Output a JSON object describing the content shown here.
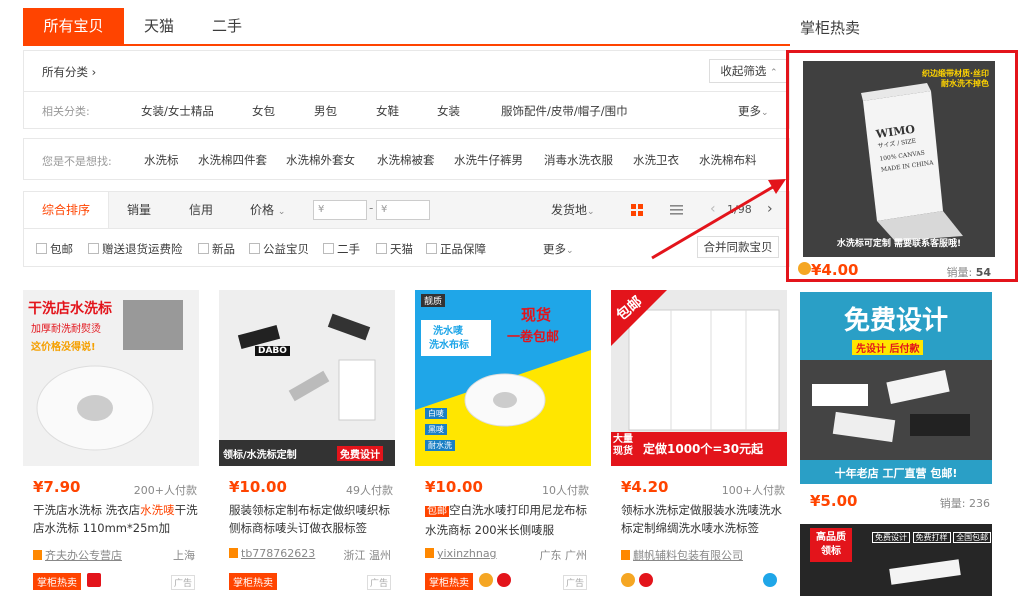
{
  "tabs": [
    {
      "label": "所有宝贝",
      "active": true
    },
    {
      "label": "天猫",
      "active": false
    },
    {
      "label": "二手",
      "active": false
    }
  ],
  "sidebar_title": "掌柜热卖",
  "filter": {
    "all_categories": "所有分类 ›",
    "collapse_btn": "收起筛选",
    "related_label": "相关分类:",
    "related_items": [
      "女装/女士精品",
      "女包",
      "男包",
      "女鞋",
      "女装",
      "服饰配件/皮带/帽子/围巾"
    ],
    "more_label": "更多",
    "suggest_label": "您是不是想找:",
    "suggest_items": [
      "水洗标",
      "水洗棉四件套",
      "水洗棉外套女",
      "水洗棉被套",
      "水洗牛仔裤男",
      "消毒水洗衣服",
      "水洗卫衣",
      "水洗棉布料"
    ]
  },
  "sort": {
    "items": [
      "综合排序",
      "销量",
      "信用",
      "价格"
    ],
    "price_min_placeholder": "¥",
    "price_dash": "-",
    "price_max_placeholder": "¥",
    "ship_from": "发货地",
    "page_indicator": "1/98"
  },
  "checks": {
    "items": [
      "包邮",
      "赠送退货运费险",
      "新品",
      "公益宝贝",
      "二手",
      "天猫",
      "正品保障"
    ],
    "more": "更多",
    "merge_btn": "合并同款宝贝"
  },
  "products": [
    {
      "img_text": [
        "干洗店水洗标",
        "加厚耐洗耐熨烫",
        "这价格没得说!"
      ],
      "price": "¥7.90",
      "paid": "200+人付款",
      "title_a": "干洗店水洗标 洗衣店",
      "title_hl": "水洗唛",
      "title_b": "干洗店水洗标 110mm*25m加",
      "shop": "齐夫办公专营店",
      "loc": "上海",
      "hot": "掌柜热卖",
      "ad": "广告"
    },
    {
      "img_text": [
        "DABO",
        "领标/水洗标定制",
        "免费设计"
      ],
      "price": "¥10.00",
      "paid": "49人付款",
      "title_a": "服装领标定制布标定做织唛织标侧标商标唛头订做衣服标签",
      "title_hl": "",
      "title_b": "",
      "shop": "tb778762623",
      "loc": "浙江 温州",
      "hot": "掌柜热卖",
      "ad": "广告"
    },
    {
      "img_text": [
        "靓质",
        "洗水唛",
        "洗水布标",
        "现货",
        "一卷包邮",
        "白唛",
        "黑唛",
        "耐水洗"
      ],
      "price": "¥10.00",
      "paid": "10人付款",
      "title_tag": "包邮",
      "title_a": "空白洗水唛打印用尼龙布标水洗商标 200米长侧唛服",
      "title_hl": "",
      "title_b": "",
      "shop": "yixinzhnag",
      "loc": "广东 广州",
      "hot": "掌柜热卖",
      "ad": "广告"
    },
    {
      "img_text": [
        "包邮",
        "大量",
        "现货",
        "定做1000个=30元起"
      ],
      "price": "¥4.20",
      "paid": "100+人付款",
      "title_a": "领标水洗标定做服装水洗唛洗水标定制绵绸洗水唛水洗标签",
      "title_hl": "",
      "title_b": "",
      "shop": "麒帆辅料包装有限公司",
      "loc": "",
      "hot": "",
      "ad": ""
    },
    {
      "img_text": [
        "免费设计",
        "先设计 后付款",
        "十年老店 工厂直营 包邮!"
      ],
      "price": "¥5.00",
      "paid": "销量: 236",
      "title_a": "",
      "title_hl": "",
      "title_b": "",
      "shop": "",
      "loc": "",
      "hot": "",
      "ad": ""
    }
  ],
  "sidebar_product": {
    "img_lines": [
      "织边缎带材质·丝印",
      "耐水洗不掉色",
      "WIMO",
      "サイズ / SIZE",
      "100% CANVAS",
      "MADE IN CHINA",
      "水洗标可定制 需要联系客服哦!"
    ],
    "price": "¥4.00",
    "sales_label": "销量:",
    "sales_value": "54"
  },
  "sixth_card_img": [
    "高品质",
    "领标",
    "免费设计",
    "免费打样",
    "全国包邮"
  ],
  "colors": {
    "accent": "#ff4400",
    "highlight_border": "#e3141b",
    "arrow": "#e3141b"
  }
}
